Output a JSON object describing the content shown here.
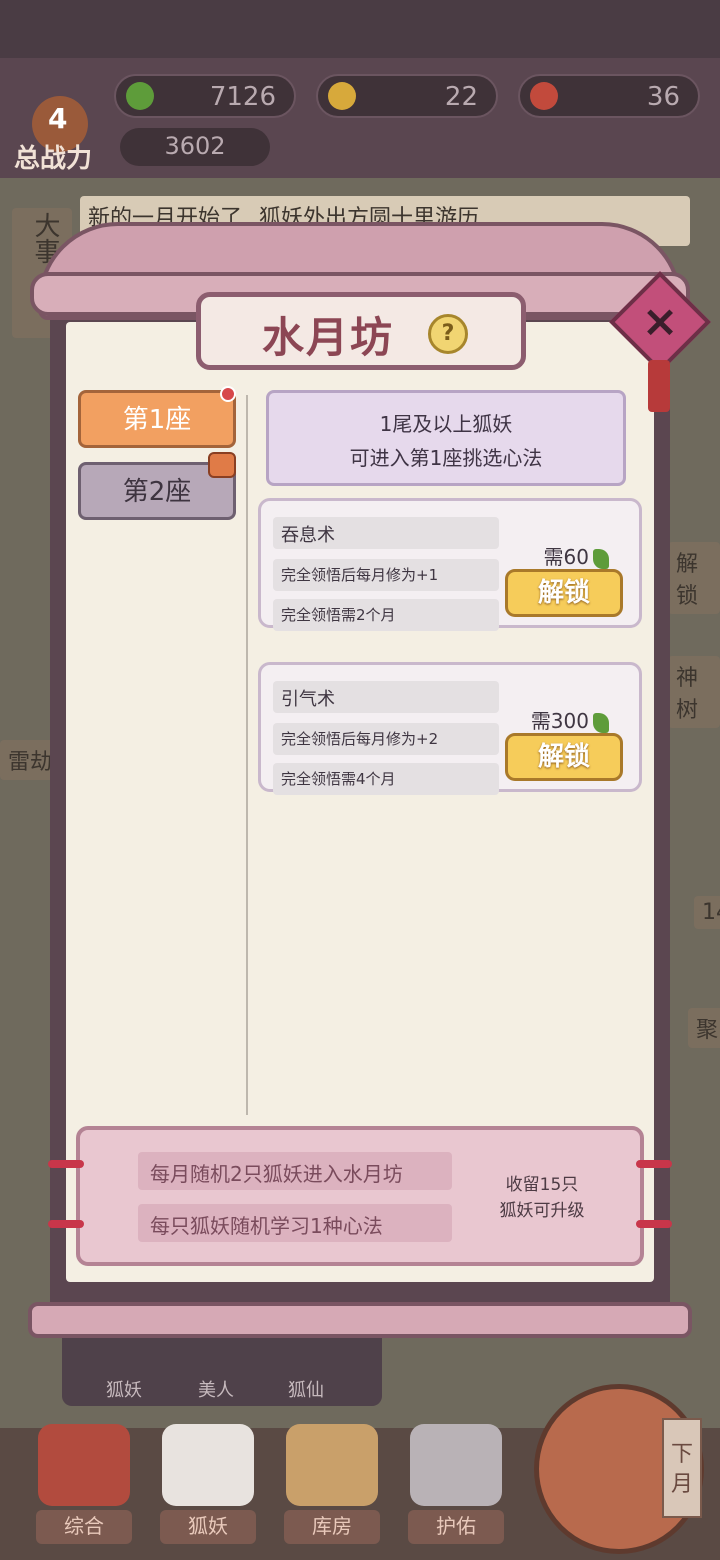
{
  "top": {
    "resources": [
      "7126",
      "22",
      "36"
    ],
    "power_level": "4",
    "power_label": "总战力",
    "power_value": "3602"
  },
  "background": {
    "left_sign": "大事",
    "news_line_1": "新的一月开始了",
    "news_line_2": "狐妖外出方圆十里游历",
    "left_label": "雷劫",
    "right_labels": [
      "解锁",
      "神树",
      "14",
      "聚"
    ]
  },
  "modal": {
    "title": "水月坊",
    "help_icon": "?",
    "tabs": [
      {
        "label": "第1座",
        "selected": true
      },
      {
        "label": "第2座",
        "selected": false
      }
    ],
    "info_line_1": "1尾及以上狐妖",
    "info_line_2": "可进入第1座挑选心法",
    "techniques": [
      {
        "name": "吞息术",
        "desc": "完全领悟后每月修为+1",
        "duration": "完全领悟需2个月",
        "price": "需60",
        "button": "解锁"
      },
      {
        "name": "引气术",
        "desc": "完全领悟后每月修为+2",
        "duration": "完全领悟需4个月",
        "price": "需300",
        "button": "解锁"
      }
    ],
    "footer": {
      "line_1": "每月随机2只狐妖进入水月坊",
      "line_2": "每只狐妖随机学习1种心法",
      "right_1": "收留15只",
      "right_2": "狐妖可升级"
    }
  },
  "categories": [
    "狐妖",
    "美人",
    "狐仙"
  ],
  "nav": [
    "综合",
    "狐妖",
    "库房",
    "护佑"
  ],
  "next_month": "下月",
  "colors": {
    "accent": "#f2a061",
    "title": "#8c4654",
    "gem": "#5e9c3a"
  }
}
